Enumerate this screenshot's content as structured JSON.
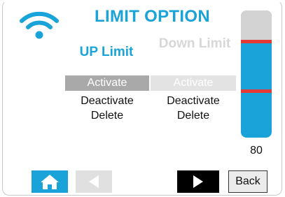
{
  "title": "LIMIT OPTION",
  "up_limit": {
    "heading": "UP Limit",
    "options": [
      "Activate",
      "Deactivate",
      "Delete"
    ]
  },
  "down_limit": {
    "heading": "Down Limit",
    "options": [
      "Activate",
      "Deactivate",
      "Delete"
    ]
  },
  "slider": {
    "value": "80",
    "upper_limit_fraction": 0.24,
    "lower_limit_fraction": 0.63,
    "colors": {
      "fill": "#1aa3d8",
      "track": "#d3d3d3",
      "limit": "#e53935"
    }
  },
  "nav": {
    "home_icon": "home-icon",
    "prev_icon": "triangle-left-icon",
    "next_icon": "triangle-right-icon",
    "back_label": "Back"
  },
  "colors": {
    "accent": "#1aa3d8",
    "muted": "#d7d7d7"
  }
}
